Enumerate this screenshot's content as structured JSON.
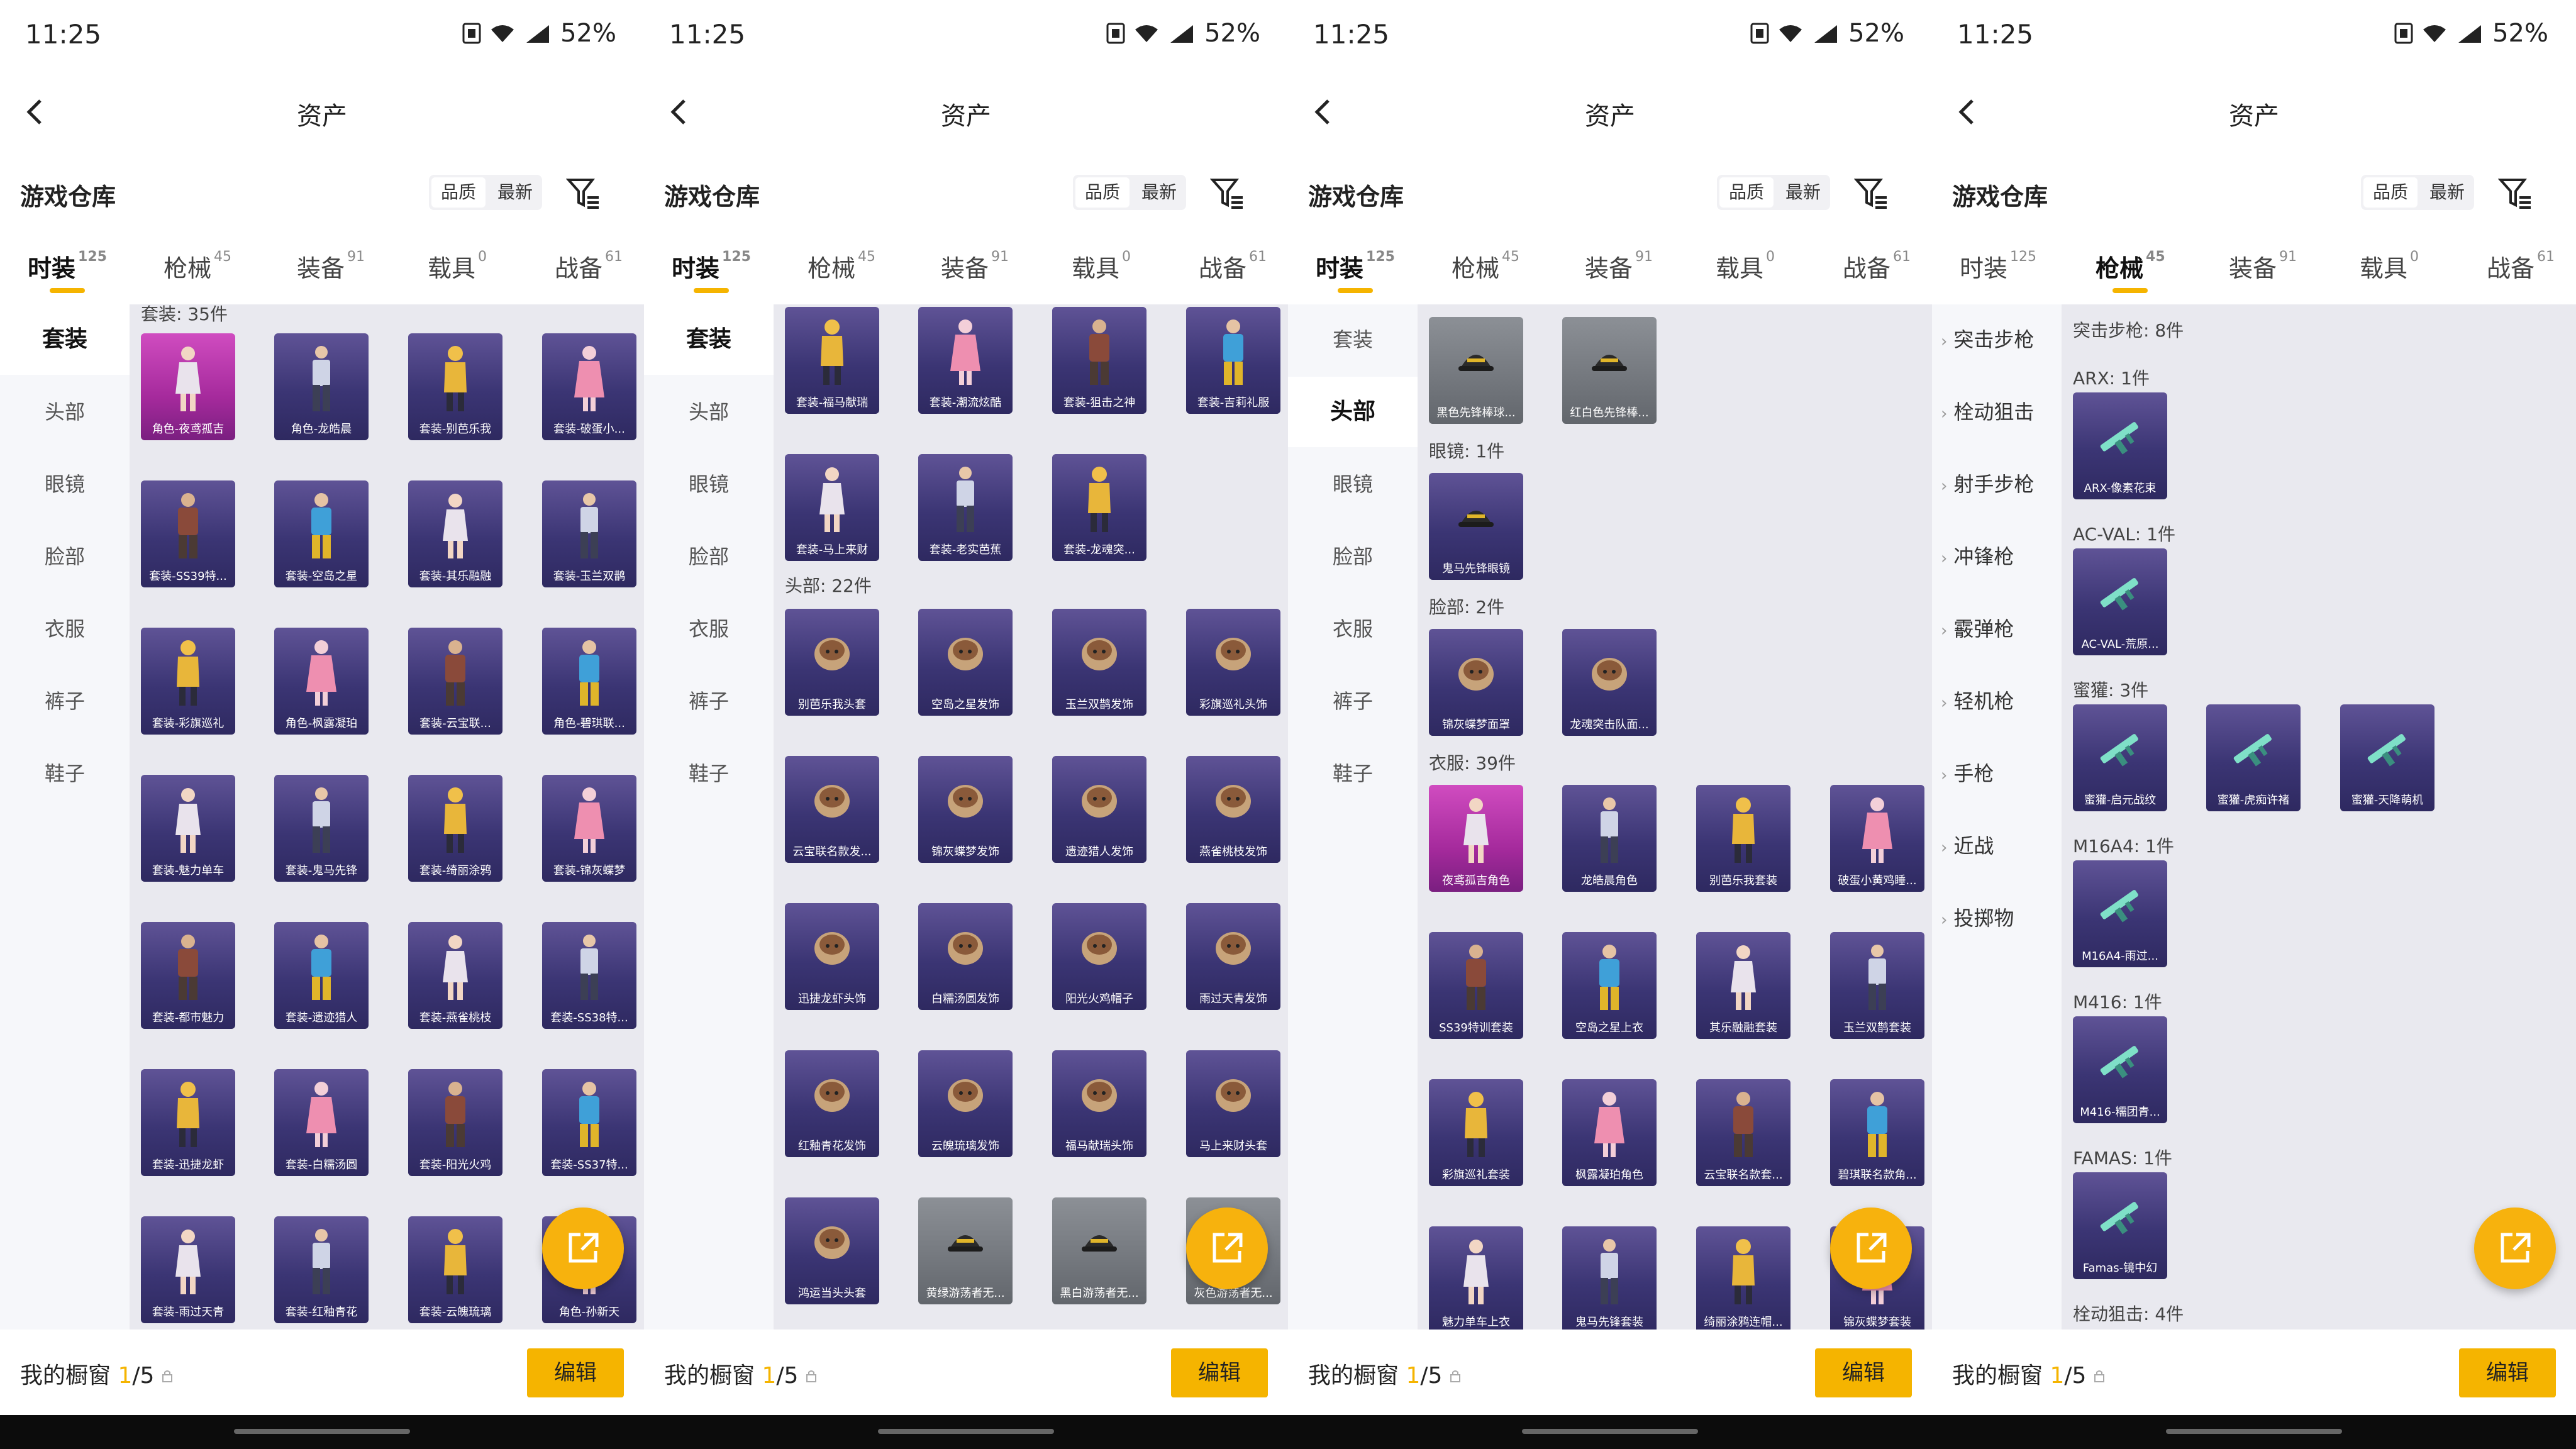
{
  "status": {
    "time": "11:25",
    "battery": "52%"
  },
  "header": {
    "title": "资产",
    "warehouse": "游戏仓库",
    "sort_quality": "品质",
    "sort_latest": "最新"
  },
  "tabs": [
    {
      "label": "时装",
      "count": "125"
    },
    {
      "label": "枪械",
      "count": "45"
    },
    {
      "label": "装备",
      "count": "91"
    },
    {
      "label": "载具",
      "count": "0"
    },
    {
      "label": "战备",
      "count": "61"
    }
  ],
  "fashion_categories": [
    "套装",
    "头部",
    "眼镜",
    "脸部",
    "衣服",
    "裤子",
    "鞋子"
  ],
  "weapon_categories": [
    "突击步枪",
    "栓动狙击",
    "射手步枪",
    "冲锋枪",
    "霰弹枪",
    "轻机枪",
    "手枪",
    "近战",
    "投掷物"
  ],
  "bottom": {
    "showcase_label": "我的橱窗",
    "showcase_current": "1",
    "showcase_total": "/5",
    "edit": "编辑"
  },
  "panel1": {
    "section": "套装: 35件",
    "items": [
      "角色-夜鸢孤吉",
      "角色-龙皓晨",
      "套装-别芭乐我",
      "套装-破蛋小...",
      "套装-SS39特...",
      "套装-空岛之星",
      "套装-其乐融融",
      "套装-玉兰双鹊",
      "套装-彩旗巡礼",
      "角色-枫露凝珀",
      "套装-云宝联...",
      "角色-碧琪联...",
      "套装-魅力单车",
      "套装-鬼马先锋",
      "套装-绮丽涂鸦",
      "套装-锦灰蝶梦",
      "套装-都市魅力",
      "套装-遗迹猎人",
      "套装-燕雀桃枝",
      "套装-SS38特...",
      "套装-迅捷龙虾",
      "套装-白糯汤圆",
      "套装-阳光火鸡",
      "套装-SS37特...",
      "套装-雨过天青",
      "套装-红釉青花",
      "套装-云魄琉璃",
      "角色-孙新天"
    ]
  },
  "panel2": {
    "items_top": [
      "套装-福马献瑞",
      "套装-潮流炫酷",
      "套装-狙击之神",
      "套装-吉莉礼服",
      "套装-马上来财",
      "套装-老实芭蕉",
      "套装-龙魂突..."
    ],
    "section": "头部: 22件",
    "items": [
      "别芭乐我头套",
      "空岛之星发饰",
      "玉兰双鹊发饰",
      "彩旗巡礼头饰",
      "云宝联名款发...",
      "锦灰蝶梦发饰",
      "遗迹猎人发饰",
      "燕雀桃枝发饰",
      "迅捷龙虾头饰",
      "白糯汤圆发饰",
      "阳光火鸡帽子",
      "雨过天青发饰",
      "红釉青花发饰",
      "云魄琉璃发饰",
      "福马献瑞头饰",
      "马上来财头套",
      "鸿运当头头套",
      "黄绿游荡者无...",
      "黑白游荡者无...",
      "灰色游荡者无..."
    ]
  },
  "panel3": {
    "items_hat": [
      "黑色先锋棒球...",
      "红白色先锋棒..."
    ],
    "section_glasses": "眼镜: 1件",
    "items_glasses": [
      "鬼马先锋眼镜"
    ],
    "section_face": "脸部: 2件",
    "items_face": [
      "锦灰蝶梦面罩",
      "龙魂突击队面..."
    ],
    "section_clothes": "衣服: 39件",
    "items_clothes": [
      "夜鸢孤吉角色",
      "龙皓晨角色",
      "别芭乐我套装",
      "破蛋小黄鸡睡...",
      "SS39特训套装",
      "空岛之星上衣",
      "其乐融融套装",
      "玉兰双鹊套装",
      "彩旗巡礼套装",
      "枫露凝珀角色",
      "云宝联名款套...",
      "碧琪联名款角...",
      "魅力单车上衣",
      "鬼马先锋套装",
      "绮丽涂鸦连帽...",
      "锦灰蝶梦套装"
    ]
  },
  "panel4": {
    "section_ar": "突击步枪: 8件",
    "groups": [
      {
        "name": "ARX: 1件",
        "items": [
          "ARX-像素花束"
        ]
      },
      {
        "name": "AC-VAL: 1件",
        "items": [
          "AC-VAL-荒原..."
        ]
      },
      {
        "name": "蜜獾: 3件",
        "items": [
          "蜜獾-启元战纹",
          "蜜獾-虎痴许褚",
          "蜜獾-天降萌机"
        ]
      },
      {
        "name": "M16A4: 1件",
        "items": [
          "M16A4-雨过..."
        ]
      },
      {
        "name": "M416: 1件",
        "items": [
          "M416-糯团青..."
        ]
      },
      {
        "name": "FAMAS: 1件",
        "items": [
          "Famas-镜中幻"
        ]
      }
    ],
    "section_bolt": "栓动狙击: 4件"
  }
}
